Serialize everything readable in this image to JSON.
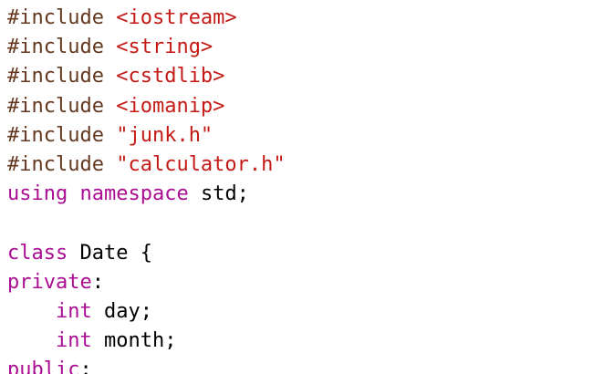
{
  "colors": {
    "directive": "#643820",
    "header_string": "#c41a16",
    "keyword": "#aa0d91",
    "plain": "#000000",
    "background": "#ffffff"
  },
  "lines": [
    {
      "tokens": [
        {
          "t": "directive",
          "v": "#include "
        },
        {
          "t": "header",
          "v": "<iostream>"
        }
      ]
    },
    {
      "tokens": [
        {
          "t": "directive",
          "v": "#include "
        },
        {
          "t": "header",
          "v": "<string>"
        }
      ]
    },
    {
      "tokens": [
        {
          "t": "directive",
          "v": "#include "
        },
        {
          "t": "header",
          "v": "<cstdlib>"
        }
      ]
    },
    {
      "tokens": [
        {
          "t": "directive",
          "v": "#include "
        },
        {
          "t": "header",
          "v": "<iomanip>"
        }
      ]
    },
    {
      "tokens": [
        {
          "t": "directive",
          "v": "#include "
        },
        {
          "t": "header",
          "v": "\"junk.h\""
        }
      ]
    },
    {
      "tokens": [
        {
          "t": "directive",
          "v": "#include "
        },
        {
          "t": "header",
          "v": "\"calculator.h\""
        }
      ]
    },
    {
      "tokens": [
        {
          "t": "keyword",
          "v": "using"
        },
        {
          "t": "plain",
          "v": " "
        },
        {
          "t": "keyword",
          "v": "namespace"
        },
        {
          "t": "plain",
          "v": " std;"
        }
      ]
    },
    {
      "tokens": []
    },
    {
      "tokens": [
        {
          "t": "keyword",
          "v": "class"
        },
        {
          "t": "plain",
          "v": " Date {"
        }
      ]
    },
    {
      "tokens": [
        {
          "t": "keyword",
          "v": "private"
        },
        {
          "t": "plain",
          "v": ":"
        }
      ]
    },
    {
      "tokens": [
        {
          "t": "plain",
          "v": "    "
        },
        {
          "t": "keyword",
          "v": "int"
        },
        {
          "t": "plain",
          "v": " day;"
        }
      ]
    },
    {
      "tokens": [
        {
          "t": "plain",
          "v": "    "
        },
        {
          "t": "keyword",
          "v": "int"
        },
        {
          "t": "plain",
          "v": " month;"
        }
      ]
    },
    {
      "tokens": [
        {
          "t": "keyword",
          "v": "public"
        },
        {
          "t": "plain",
          "v": ":"
        }
      ]
    }
  ]
}
